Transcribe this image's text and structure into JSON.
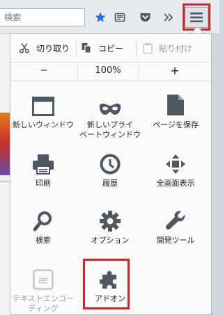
{
  "toolbar": {
    "search_placeholder": "検索",
    "icons": [
      "bookmark-star-icon",
      "reading-list-icon",
      "pocket-icon",
      "overflow-chevron-icon",
      "hamburger-menu-icon"
    ]
  },
  "edit": {
    "cut": "切り取り",
    "copy": "コピー",
    "paste": "貼り付け"
  },
  "zoom": {
    "minus": "−",
    "level": "100%",
    "plus": "+"
  },
  "menu_items": {
    "new_window": "新しいウィンドウ",
    "private_window_1": "新しいプライ",
    "private_window_2": "ベートウィンドウ",
    "save_page": "ページを保存",
    "print": "印刷",
    "history": "履歴",
    "fullscreen": "全画面表示",
    "find": "検索",
    "options": "オプション",
    "developer": "開発ツール",
    "encoding_1": "テキストエンコー",
    "encoding_2": "ディング",
    "addons": "アドオン"
  },
  "colors": {
    "accent_blue": "#1a73e8",
    "highlight_red": "#d8232a",
    "icon_gray": "#4e5862",
    "disabled_gray": "#bfc4c9"
  }
}
